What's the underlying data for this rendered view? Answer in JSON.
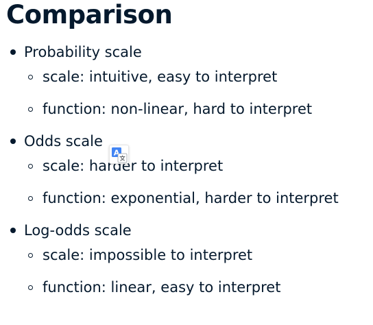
{
  "title": "Comparison",
  "sections": [
    {
      "label": "Probability scale",
      "items": [
        "scale: intuitive, easy to interpret",
        "function: non-linear, hard to interpret"
      ]
    },
    {
      "label": "Odds scale",
      "items": [
        "scale: harder to interpret",
        "function: exponential, harder to interpret"
      ]
    },
    {
      "label": "Log-odds scale",
      "items": [
        "scale: impossible to interpret",
        "function: linear, easy to interpret"
      ]
    }
  ],
  "translate_badge": {
    "icon": "translate-icon",
    "glyph": "A",
    "accent_color": "#4285f4"
  }
}
